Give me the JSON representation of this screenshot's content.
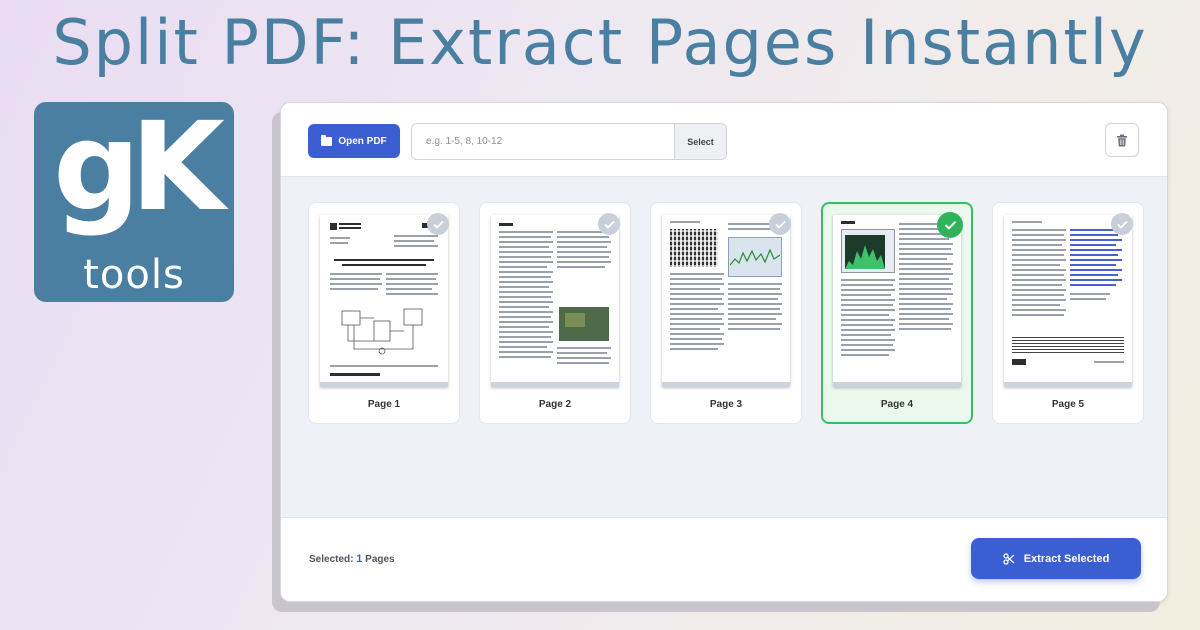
{
  "headline": "Split PDF: Extract Pages Instantly",
  "logo": {
    "mark": "gK",
    "word": "tools"
  },
  "toolbar": {
    "open_label": "Open PDF",
    "range_placeholder": "e.g. 1-5, 8, 10-12",
    "range_value": "",
    "select_label": "Select"
  },
  "pages": [
    {
      "label": "Page 1",
      "selected": false,
      "check_icon": "check-icon"
    },
    {
      "label": "Page 2",
      "selected": false,
      "check_icon": "check-icon"
    },
    {
      "label": "Page 3",
      "selected": false,
      "check_icon": "check-icon"
    },
    {
      "label": "Page 4",
      "selected": true,
      "check_icon": "check-icon"
    },
    {
      "label": "Page 5",
      "selected": false,
      "check_icon": "check-icon"
    }
  ],
  "footer": {
    "selected_prefix": "Selected:",
    "selected_count": "1",
    "selected_suffix": "Pages",
    "extract_label": "Extract Selected"
  },
  "colors": {
    "brand": "#4a7fa1",
    "accent": "#3b5ed3",
    "selected": "#2fb35a"
  }
}
